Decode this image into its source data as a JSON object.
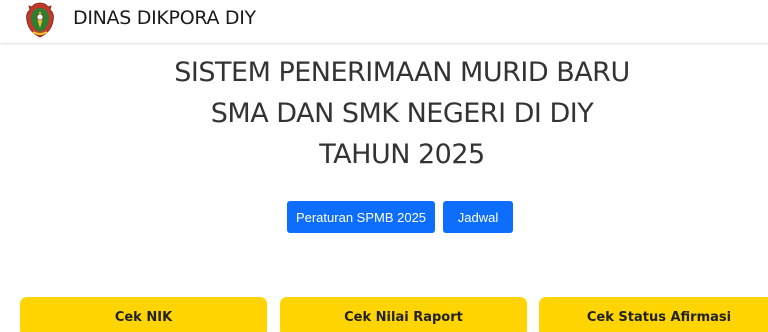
{
  "navbar": {
    "brand": "DINAS DIKPORA DIY",
    "logo_icon": "coat-of-arms-emblem"
  },
  "hero": {
    "line1": "SISTEM PENERIMAAN MURID BARU",
    "line2": "SMA DAN SMK NEGERI DI DIY",
    "line3": "TAHUN 2025"
  },
  "buttons": {
    "rules_label": "Peraturan SPMB 2025",
    "schedule_label": "Jadwal"
  },
  "cards": [
    {
      "label": "Cek NIK"
    },
    {
      "label": "Cek Nilai Raport"
    },
    {
      "label": "Cek Status Afirmasi"
    }
  ],
  "colors": {
    "primary": "#0d6efd",
    "card": "#ffd400",
    "text": "#333333"
  }
}
